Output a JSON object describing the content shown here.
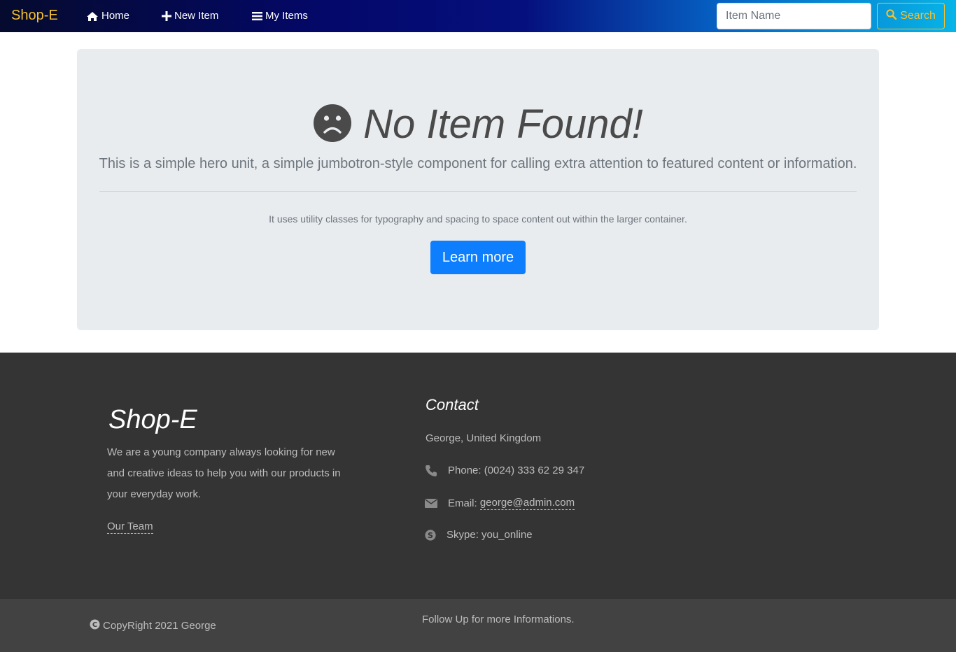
{
  "navbar": {
    "brand": "Shop-E",
    "items": [
      {
        "icon": "home-icon",
        "label": "Home"
      },
      {
        "icon": "plus-icon",
        "label": "New Item"
      },
      {
        "icon": "list-icon",
        "label": "My Items"
      }
    ],
    "search": {
      "placeholder": "Item Name",
      "value": "",
      "button_label": "Search",
      "button_icon": "search-icon"
    }
  },
  "hero": {
    "icon": "frown-icon",
    "title": "No Item Found!",
    "lead": "This is a simple hero unit, a simple jumbotron-style component for calling extra attention to featured content or information.",
    "text": "It uses utility classes for typography and spacing to space content out within the larger container.",
    "button_label": "Learn more"
  },
  "footer": {
    "brand": "Shop-E",
    "about": "We are a young company always looking for new and creative ideas to help you with our products in your everyday work.",
    "team_link": "Our Team",
    "contact": {
      "heading": "Contact",
      "location": "George, United Kingdom",
      "phone_label": "Phone: (0024) 333 62 29 347",
      "email_prefix": "Email: ",
      "email": "george@admin.com",
      "skype_label": "Skype: you_online"
    },
    "copyright": "CopyRight 2021 George",
    "follow": "Follow Up for more Informations."
  },
  "colors": {
    "brand": "#f6c12e",
    "primary_button": "#0d7efd",
    "jumbotron_bg": "#e9ecef",
    "footer_top": "#343434",
    "footer_bottom": "#424242"
  }
}
